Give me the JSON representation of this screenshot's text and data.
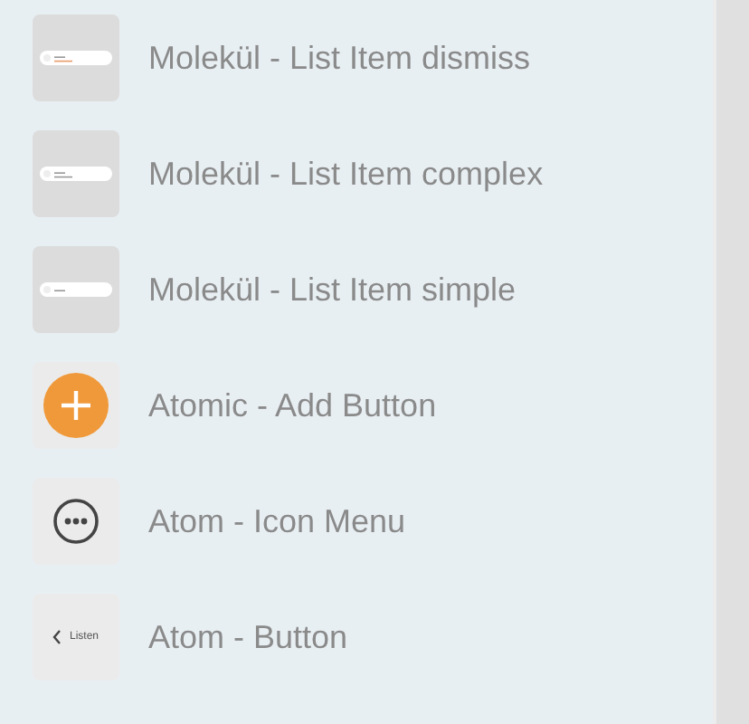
{
  "items": [
    {
      "label": "Molekül - List Item dismiss",
      "thumbnail": {
        "kind": "list-item-dismiss"
      }
    },
    {
      "label": "Molekül - List Item complex",
      "thumbnail": {
        "kind": "list-item-complex"
      }
    },
    {
      "label": "Molekül - List Item simple",
      "thumbnail": {
        "kind": "list-item-simple"
      }
    },
    {
      "label": "Atomic - Add Button",
      "thumbnail": {
        "kind": "add-button"
      }
    },
    {
      "label": "Atom - Icon Menu",
      "thumbnail": {
        "kind": "icon-menu"
      }
    },
    {
      "label": "Atom - Button",
      "thumbnail": {
        "kind": "back-button",
        "text": "Listen"
      }
    }
  ]
}
